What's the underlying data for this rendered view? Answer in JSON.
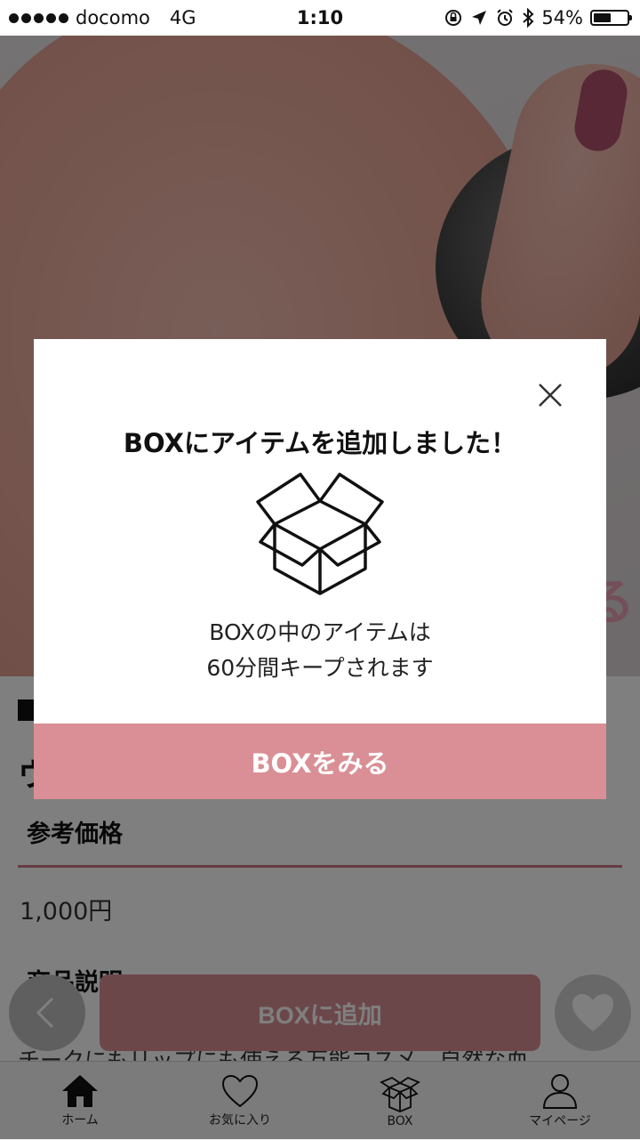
{
  "status_bar": {
    "carrier": "docomo",
    "network": "4G",
    "time": "1:10",
    "battery": "54%",
    "battery_level": 0.54
  },
  "hero": {
    "overlay_text": "る"
  },
  "product": {
    "title_char": "ウ",
    "price_label": "参考価格",
    "price": "1,000円",
    "description_label": "商品説明",
    "description_text": "チークにもリップにも使える万能コスメ。自然な血"
  },
  "actions": {
    "add_to_box": "BOXに追加"
  },
  "tabbar": {
    "items": [
      {
        "label": "ホーム",
        "icon": "home-icon"
      },
      {
        "label": "お気に入り",
        "icon": "heart-outline-icon"
      },
      {
        "label": "BOX",
        "icon": "box-icon"
      },
      {
        "label": "マイページ",
        "icon": "person-icon"
      }
    ]
  },
  "modal": {
    "title": "BOXにアイテムを追加しました！",
    "message_line1": "BOXの中のアイテムは",
    "message_line2": "60分間キープされます",
    "button": "BOXをみる",
    "icon": "open-box-icon"
  },
  "colors": {
    "accent": "#d98f95",
    "divider": "#c97a82"
  }
}
